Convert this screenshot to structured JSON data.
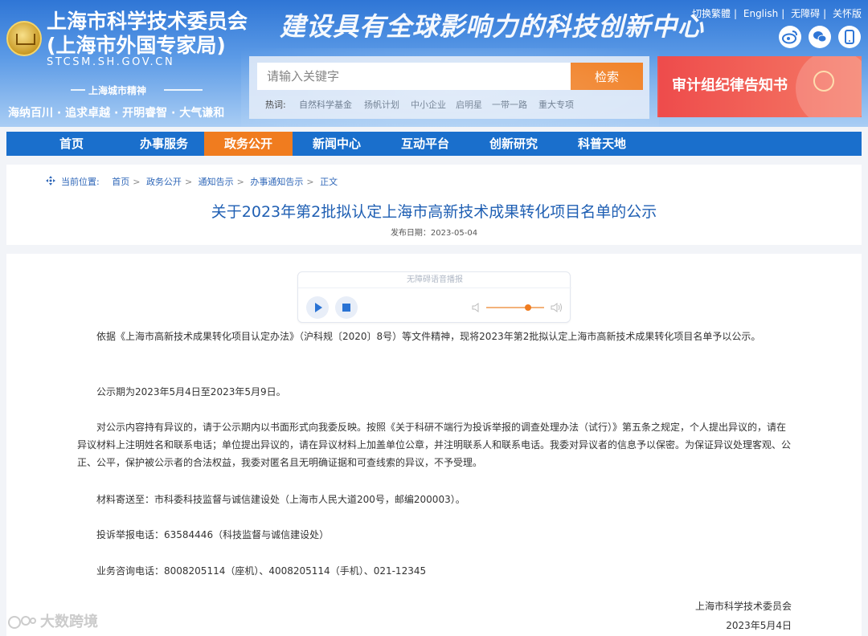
{
  "header": {
    "site_name": "上海市科学技术委员会",
    "site_sub": "(上海市外国专家局)",
    "site_domain": "STCSM.SH.GOV.CN",
    "spirit_title": "上海城市精神",
    "spirit_text": "海纳百川 · 追求卓越 · 开明睿智 · 大气谦和",
    "slogan": "建设具有全球影响力的科技创新中心",
    "top_links": [
      "切换繁體",
      "English",
      "无障碍",
      "关怀版"
    ],
    "social_icons": [
      "weibo-icon",
      "wechat-icon",
      "mobile-icon"
    ]
  },
  "search": {
    "placeholder": "请输入关键字",
    "button_label": "检索",
    "hot_label": "热词:",
    "hot_words": [
      "自然科学基金",
      "扬帆计划",
      "中小企业",
      "启明星",
      "一带一路",
      "重大专项"
    ]
  },
  "banner": {
    "text": "审计组纪律告知书"
  },
  "nav": {
    "items": [
      "首页",
      "办事服务",
      "政务公开",
      "新闻中心",
      "互动平台",
      "创新研究",
      "科普天地"
    ],
    "active": "政务公开"
  },
  "breadcrumb": {
    "label": "当前位置:",
    "items": [
      "首页",
      "政务公开",
      "通知告示",
      "办事通知告示",
      "正文"
    ]
  },
  "article": {
    "title": "关于2023年第2批拟认定上海市高新技术成果转化项目名单的公示",
    "date": "发布日期：2023-05-04",
    "player_title": "无障碍语音播报",
    "volume_level": 0.72,
    "paragraphs": [
      "依据《上海市高新技术成果转化项目认定办法》（沪科规〔2020〕8号）等文件精神，现将2023年第2批拟认定上海市高新技术成果转化项目名单予以公示。",
      "公示期为2023年5月4日至2023年5月9日。",
      "对公示内容持有异议的，请于公示期内以书面形式向我委反映。按照《关于科研不端行为投诉举报的调查处理办法（试行）》第五条之规定，个人提出异议的，请在异议材料上注明姓名和联系电话；单位提出异议的，请在异议材料上加盖单位公章，并注明联系人和联系电话。我委对异议者的信息予以保密。为保证异议处理客观、公正、公平，保护被公示者的合法权益，我委对匿名且无明确证据和可查线索的异议，不予受理。",
      "材料寄送至：市科委科技监督与诚信建设处（上海市人民大道200号，邮编200003）。",
      "投诉举报电话：63584446（科技监督与诚信建设处）",
      "业务咨询电话：8008205114（座机）、4008205114（手机）、021-12345"
    ],
    "signature_org": "上海市科学技术委员会",
    "signature_date": "2023年5月4日"
  },
  "watermark": {
    "text": "大数跨境"
  }
}
